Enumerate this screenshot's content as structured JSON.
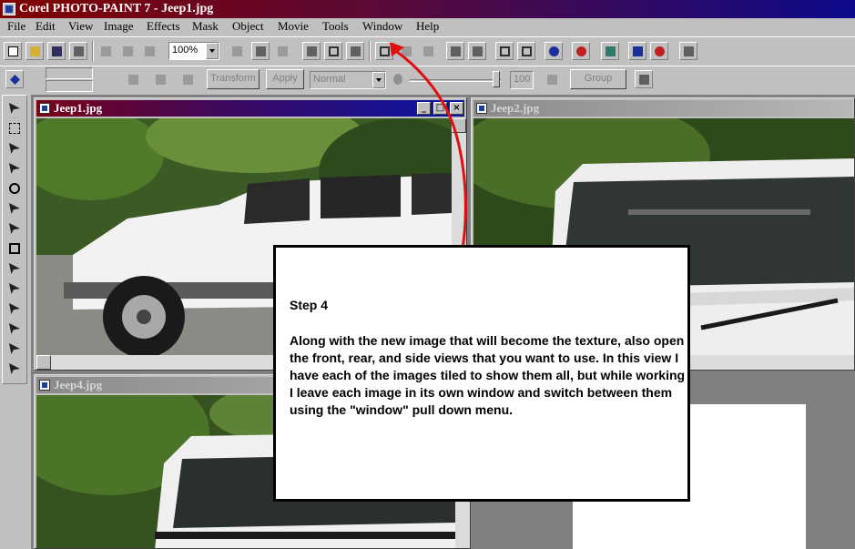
{
  "window": {
    "title": "Corel PHOTO-PAINT 7 - Jeep1.jpg"
  },
  "menu": [
    "File",
    "Edit",
    "View",
    "Image",
    "Effects",
    "Mask",
    "Object",
    "Movie",
    "Tools",
    "Window",
    "Help"
  ],
  "toolbar": {
    "zoom": "100%"
  },
  "property_bar": {
    "transform": "Transform",
    "apply": "Apply",
    "merge_mode": "Normal",
    "opacity": "100",
    "group": "Group"
  },
  "documents": {
    "jeep1": "Jeep1.jpg",
    "jeep2": "Jeep2.jpg",
    "jeep4": "Jeep4.jpg"
  },
  "callout": {
    "title": "Step 4",
    "body": "Along with the new image that will become the texture, also open the front, rear, and side views that you want to use. In this view   I have each of the images tiled to show them all, but     while working I leave each image in its own window and switch between them using the \"window\" pull down menu."
  },
  "colors": {
    "arrow": "#e01010",
    "active_caption_start": "#7a0018",
    "active_caption_end": "#0a16a8"
  }
}
